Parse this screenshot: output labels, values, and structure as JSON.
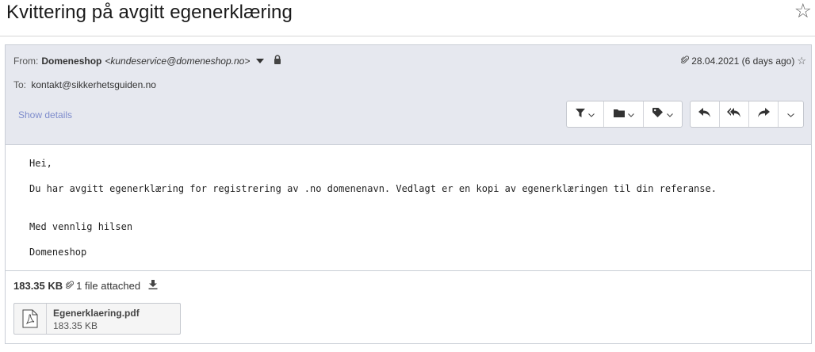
{
  "subject": "Kvittering på avgitt egenerklæring",
  "headers": {
    "from_label": "From:",
    "from_name": "Domeneshop",
    "from_address": "<kundeservice@domeneshop.no>",
    "to_label": "To:",
    "to_address": "kontakt@sikkerhetsguiden.no",
    "date": "28.04.2021 (6 days ago)",
    "show_details": "Show details"
  },
  "toolbar": {
    "group_a": [
      "filter-icon",
      "folder-icon",
      "tag-icon"
    ],
    "group_b": [
      "reply-icon",
      "reply-all-icon",
      "forward-icon",
      "more-chevron-icon"
    ]
  },
  "body": {
    "lines": [
      "Hei,",
      "Du har avgitt egenerklæring for registrering av .no domenenavn. Vedlagt er en kopi av egenerklæringen til din referanse.",
      "Med vennlig hilsen",
      "Domeneshop"
    ]
  },
  "attachments": {
    "total_size": "183.35 KB",
    "count_text": "1 file attached",
    "files": [
      {
        "name": "Egenerklaering.pdf",
        "size": "183.35 KB",
        "icon": "pdf-icon"
      }
    ]
  },
  "colors": {
    "header_bg": "#e6e8ef",
    "link": "#7e8ccc",
    "border": "#c9ced6"
  }
}
